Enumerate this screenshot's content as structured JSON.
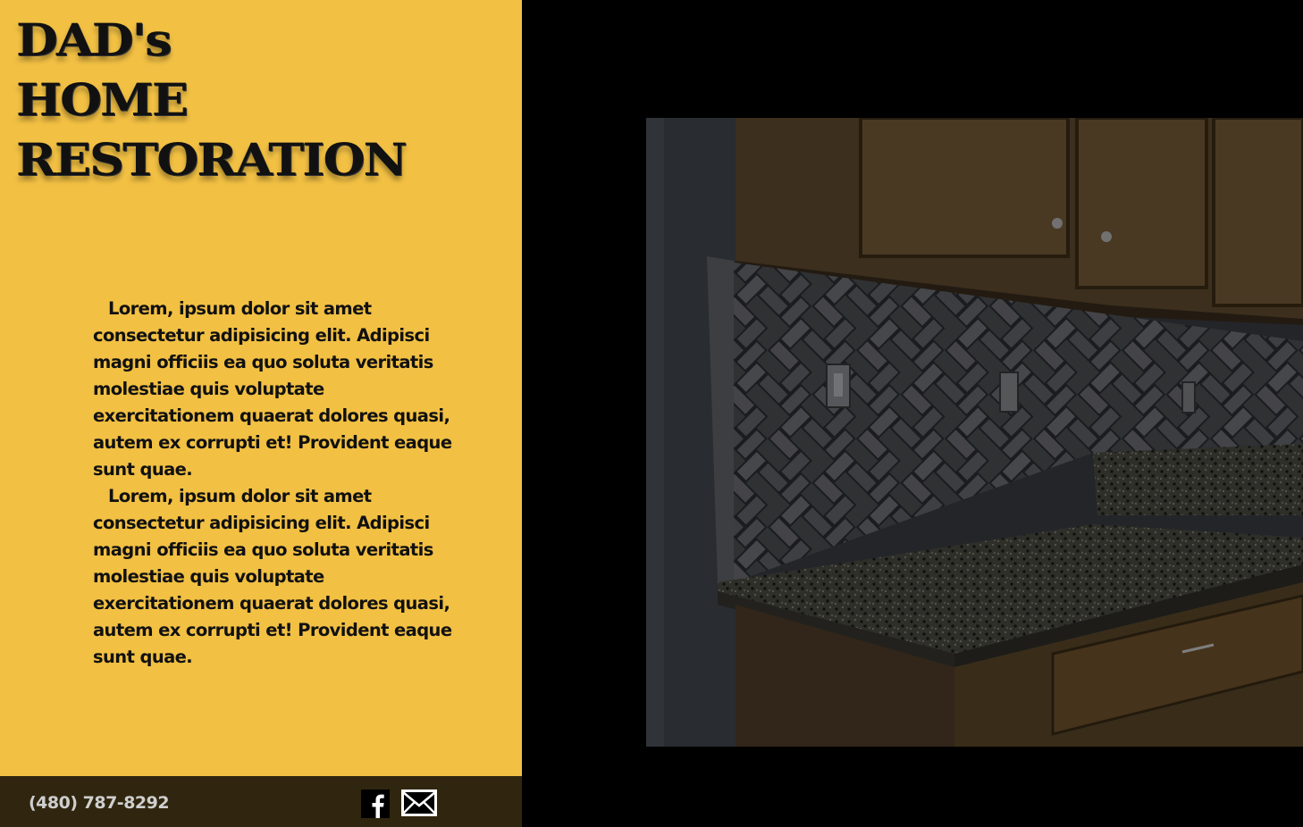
{
  "brand": {
    "line1": "DAD's",
    "line2": "HOME",
    "line3": "RESTORATION"
  },
  "content": {
    "paragraphs": [
      "Lorem, ipsum dolor sit amet consectetur adipisicing elit. Adipisci magni officiis ea quo soluta veritatis molestiae quis voluptate exercitationem quaerat dolores quasi, autem ex corrupti et! Provident eaque sunt quae.",
      "Lorem, ipsum dolor sit amet consectetur adipisicing elit. Adipisci magni officiis ea quo soluta veritatis molestiae quis voluptate exercitationem quaerat dolores quasi, autem ex corrupti et! Provident eaque sunt quae."
    ]
  },
  "footer": {
    "phone": "(480) 787-8292",
    "icons": [
      "facebook-icon",
      "mail-icon"
    ]
  },
  "hero": {
    "subject": "kitchen backsplash with herringbone tile and granite countertop"
  },
  "colors": {
    "panel": "#f2c043",
    "footer": "#30260f",
    "background": "#000000",
    "text": "#111111",
    "phone": "#cfcfcf"
  }
}
